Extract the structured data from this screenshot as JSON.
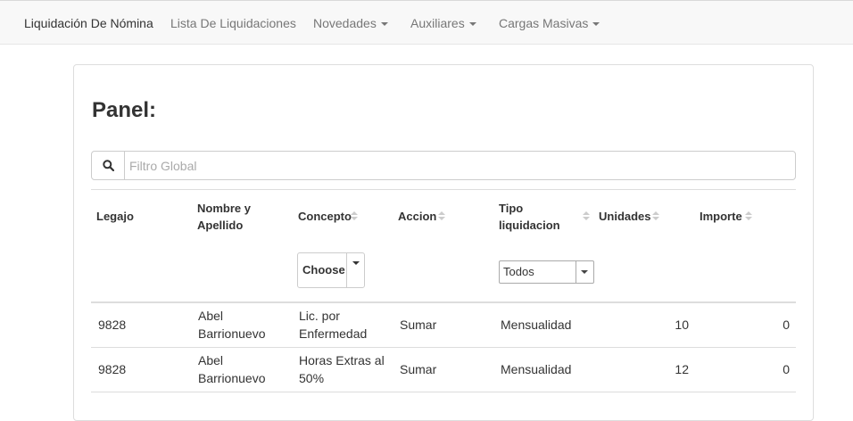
{
  "navbar": {
    "brand": "Liquidación De Nómina",
    "items": [
      {
        "label": "Lista De Liquidaciones",
        "dropdown": false
      },
      {
        "label": "Novedades",
        "dropdown": true
      },
      {
        "label": "Auxiliares",
        "dropdown": true
      },
      {
        "label": "Cargas Masivas",
        "dropdown": true
      }
    ]
  },
  "panel": {
    "title": "Panel:",
    "search": {
      "placeholder": "Filtro Global",
      "value": "",
      "icon": "search-icon"
    }
  },
  "table": {
    "columns": [
      {
        "key": "legajo",
        "label": "Legajo",
        "sortable": false
      },
      {
        "key": "nombre",
        "label": "Nombre y Apellido",
        "sortable": false
      },
      {
        "key": "concepto",
        "label": "Concepto",
        "sortable": true
      },
      {
        "key": "accion",
        "label": "Accion",
        "sortable": true
      },
      {
        "key": "tipo",
        "label": "Tipo liquidacion",
        "sortable": true
      },
      {
        "key": "unidades",
        "label": "Unidades",
        "sortable": true
      },
      {
        "key": "importe",
        "label": "Importe",
        "sortable": true
      }
    ],
    "filters": {
      "concepto": {
        "label": "Choose"
      },
      "tipo": {
        "selected": "Todos"
      }
    },
    "rows": [
      {
        "legajo": "9828",
        "nombre": "Abel Barrionuevo",
        "concepto": "Lic. por Enfermedad",
        "accion": "Sumar",
        "tipo": "Mensualidad",
        "unidades": "10",
        "importe": "0"
      },
      {
        "legajo": "9828",
        "nombre": "Abel Barrionuevo",
        "concepto": "Horas Extras al 50%",
        "accion": "Sumar",
        "tipo": "Mensualidad",
        "unidades": "12",
        "importe": "0"
      }
    ]
  },
  "colors": {
    "navbar_bg": "#f8f8f8",
    "border": "#dddddd",
    "text": "#333333",
    "nav_text": "#777777"
  }
}
